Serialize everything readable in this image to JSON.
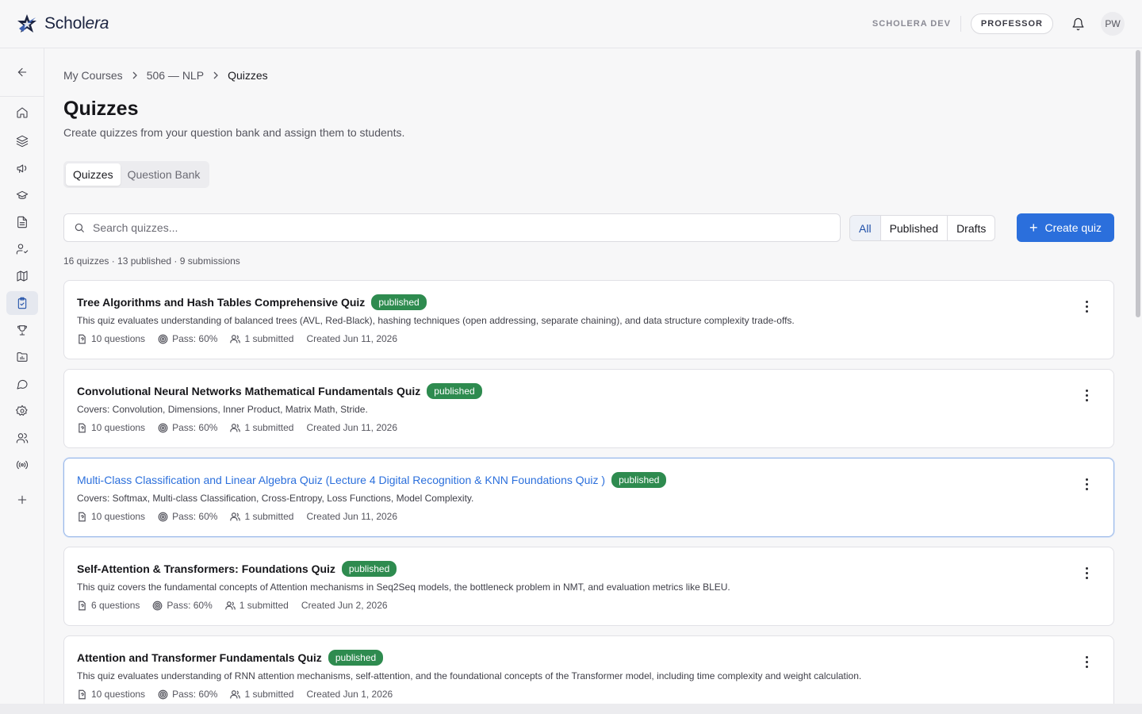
{
  "app": {
    "logo_text_a": "Schol",
    "logo_text_b": "era",
    "env_label": "SCHOLERA DEV",
    "role_label": "PROFESSOR",
    "avatar_initials": "PW",
    "accent_color": "#2b6fdc",
    "published_color": "#2e8b4f"
  },
  "sidebar": {
    "items": [
      {
        "icon": "arrow-left-icon"
      },
      {
        "icon": "home-icon"
      },
      {
        "icon": "layers-icon"
      },
      {
        "icon": "megaphone-icon"
      },
      {
        "icon": "graduation-cap-icon"
      },
      {
        "icon": "document-icon"
      },
      {
        "icon": "user-check-icon"
      },
      {
        "icon": "map-icon"
      },
      {
        "icon": "clipboard-check-icon",
        "active": true
      },
      {
        "icon": "trophy-icon"
      },
      {
        "icon": "folder-chart-icon"
      },
      {
        "icon": "chat-icon"
      },
      {
        "icon": "gear-icon"
      },
      {
        "icon": "users-icon"
      },
      {
        "icon": "broadcast-icon"
      },
      {
        "icon": "plus-icon"
      }
    ]
  },
  "breadcrumb": {
    "items": [
      "My Courses",
      "506 — NLP",
      "Quizzes"
    ]
  },
  "page": {
    "title": "Quizzes",
    "subtitle": "Create quizzes from your question bank and assign them to students."
  },
  "tabs": {
    "items": [
      "Quizzes",
      "Question Bank"
    ],
    "selected": "Quizzes"
  },
  "search": {
    "placeholder": "Search quizzes...",
    "value": ""
  },
  "filters": {
    "items": [
      "All",
      "Published",
      "Drafts"
    ],
    "selected": "All"
  },
  "create_button": {
    "label": "Create quiz"
  },
  "summary": "16 quizzes · 13 published · 9 submissions",
  "quizzes": [
    {
      "title": "Tree Algorithms and Hash Tables Comprehensive Quiz",
      "status": "published",
      "description": "This quiz evaluates understanding of balanced trees (AVL, Red-Black), hashing techniques (open addressing, separate chaining), and data structure complexity trade-offs.",
      "questions": "10 questions",
      "pass": "Pass: 60%",
      "submitted": "1 submitted",
      "created": "Created Jun 11, 2026"
    },
    {
      "title": "Convolutional Neural Networks Mathematical Fundamentals Quiz",
      "status": "published",
      "description": "Covers: Convolution, Dimensions, Inner Product, Matrix Math, Stride.",
      "questions": "10 questions",
      "pass": "Pass: 60%",
      "submitted": "1 submitted",
      "created": "Created Jun 11, 2026"
    },
    {
      "title": "Multi-Class Classification and Linear Algebra Quiz (Lecture 4 Digital Recognition & KNN Foundations Quiz )",
      "status": "published",
      "description": "Covers: Softmax, Multi-class Classification, Cross-Entropy, Loss Functions, Model Complexity.",
      "questions": "10 questions",
      "pass": "Pass: 60%",
      "submitted": "1 submitted",
      "created": "Created Jun 11, 2026",
      "highlighted": true
    },
    {
      "title": "Self-Attention & Transformers: Foundations Quiz",
      "status": "published",
      "description": "This quiz covers the fundamental concepts of Attention mechanisms in Seq2Seq models, the bottleneck problem in NMT, and evaluation metrics like BLEU.",
      "questions": "6 questions",
      "pass": "Pass: 60%",
      "submitted": "1 submitted",
      "created": "Created Jun 2, 2026"
    },
    {
      "title": "Attention and Transformer Fundamentals Quiz",
      "status": "published",
      "description": "This quiz evaluates understanding of RNN attention mechanisms, self-attention, and the foundational concepts of the Transformer model, including time complexity and weight calculation.",
      "questions": "10 questions",
      "pass": "Pass: 60%",
      "submitted": "1 submitted",
      "created": "Created Jun 1, 2026"
    }
  ]
}
